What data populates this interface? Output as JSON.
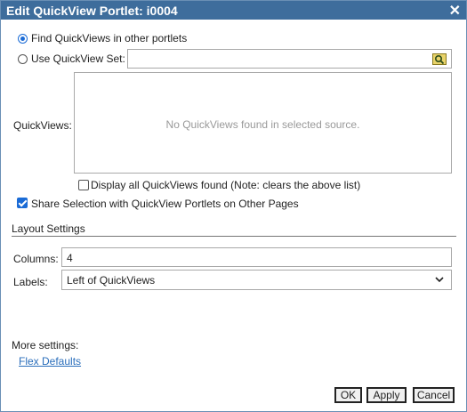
{
  "dialog": {
    "title": "Edit QuickView Portlet: i0004",
    "close_glyph": "✕"
  },
  "source": {
    "find_label": "Find QuickViews in other portlets",
    "find_selected": true,
    "use_set_label": "Use QuickView Set:",
    "use_set_value": "",
    "browse_icon": "folder-search-icon"
  },
  "quickviews": {
    "label": "QuickViews:",
    "empty_message": "No QuickViews found in selected source."
  },
  "display_all": {
    "label": "Display all QuickViews found (Note: clears the above list)",
    "checked": false
  },
  "share_selection": {
    "label": "Share Selection with QuickView Portlets on Other Pages",
    "checked": true
  },
  "layout": {
    "heading": "Layout Settings",
    "columns_label": "Columns:",
    "columns_value": "4",
    "labels_label": "Labels:",
    "labels_value": "Left of QuickViews"
  },
  "more": {
    "heading": "More settings:",
    "flex_defaults": "Flex Defaults"
  },
  "buttons": {
    "ok": "OK",
    "apply": "Apply",
    "cancel": "Cancel"
  },
  "colors": {
    "titlebar": "#3e6d9c",
    "accent": "#1a6bd6",
    "link": "#2a6ebb"
  }
}
